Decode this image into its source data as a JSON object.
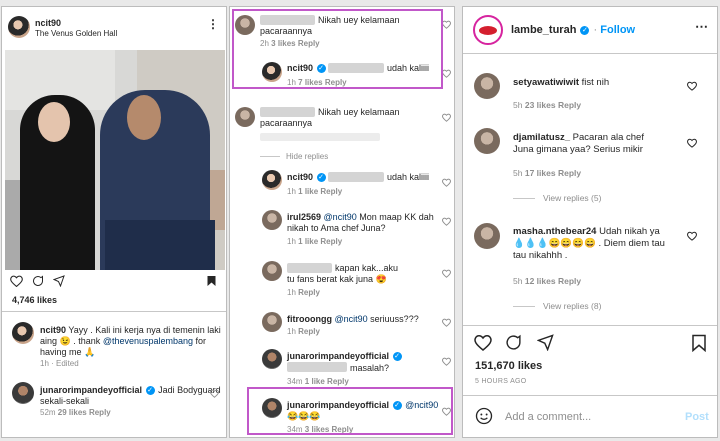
{
  "left": {
    "username": "ncit90",
    "location": "The Venus Golden Hall",
    "likes": "4,746 likes",
    "caption_user": "ncit90",
    "caption": [
      "Yayy . Kali ini kerja nya di temenin laki",
      "aing",
      ". thank",
      "@thevenuspalembang",
      "for",
      "having me"
    ],
    "caption_emoji": "😉",
    "caption_emoji2": "🙏",
    "caption_meta": "1h · Edited",
    "comment_user": "junarorimpandeyofficial",
    "comment_text": [
      "Jadi Bodyguard",
      "sekali-sekali"
    ],
    "comment_time": "52m",
    "comment_likes": "29 likes",
    "comment_reply": "Reply"
  },
  "middle": {
    "c1_text": [
      "Nikah uey kelamaan",
      "pacaraannya"
    ],
    "c1_time": "2h",
    "c1_likes": "3 likes",
    "c1_reply": "Reply",
    "r1_user": "ncit90",
    "r1_text": "udah kaliiii",
    "r1_time": "1h",
    "r1_likes": "7 likes",
    "r1_reply": "Reply",
    "c2_text": [
      "Nikah uey kelamaan",
      "pacaraannya"
    ],
    "hide_replies": "Hide replies",
    "r2_user": "ncit90",
    "r2_text": "udah kaliiii",
    "r2_time": "1h",
    "r2_likes": "1 like",
    "r2_reply": "Reply",
    "r3_user": "irul2569",
    "r3_mention": "@ncit90",
    "r3_text": [
      "Mon maap KK dah",
      "nikah to Ama chef Juna?"
    ],
    "r3_time": "1h",
    "r3_likes": "1 like",
    "r3_reply": "Reply",
    "r4_text": [
      "kapan kak...aku",
      "tu fans berat kak juna"
    ],
    "r4_emoji": "😍",
    "r4_time": "1h",
    "r4_reply": "Reply",
    "r5_user": "fitrooongg",
    "r5_mention": "@ncit90",
    "r5_text": "seriuuss???",
    "r5_time": "1h",
    "r5_reply": "Reply",
    "r6_user": "junarorimpandeyofficial",
    "r6_text": "masalah?",
    "r6_time": "34m",
    "r6_likes": "1 like",
    "r6_reply": "Reply",
    "r7_user": "junarorimpandeyofficial",
    "r7_mention": "@ncit90",
    "r7_text": "😂😂😂",
    "r7_time": "34m",
    "r7_likes": "3 likes",
    "r7_reply": "Reply"
  },
  "right": {
    "username": "lambe_turah",
    "follow": "Follow",
    "c1_user": "setyawatiwiwit",
    "c1_text": "fist nih",
    "c1_time": "5h",
    "c1_likes": "23 likes",
    "c1_reply": "Reply",
    "c2_user": "djamilatusz_",
    "c2_text": [
      "Pacaran ala chef",
      "Juna gimana yaa? Serius mikir"
    ],
    "c2_time": "5h",
    "c2_likes": "17 likes",
    "c2_reply": "Reply",
    "c2_view": "View replies (5)",
    "c3_user": "masha.nthebear24",
    "c3_text": [
      "Udah nikah ya",
      "💧💧💧😄😄😄😄 . Diem diem tau",
      "tau nikahhh ."
    ],
    "c3_time": "5h",
    "c3_likes": "12 likes",
    "c3_reply": "Reply",
    "c3_view": "View replies (8)",
    "likes": "151,670 likes",
    "time": "5 HOURS AGO",
    "add_comment": "Add a comment...",
    "post": "Post"
  }
}
